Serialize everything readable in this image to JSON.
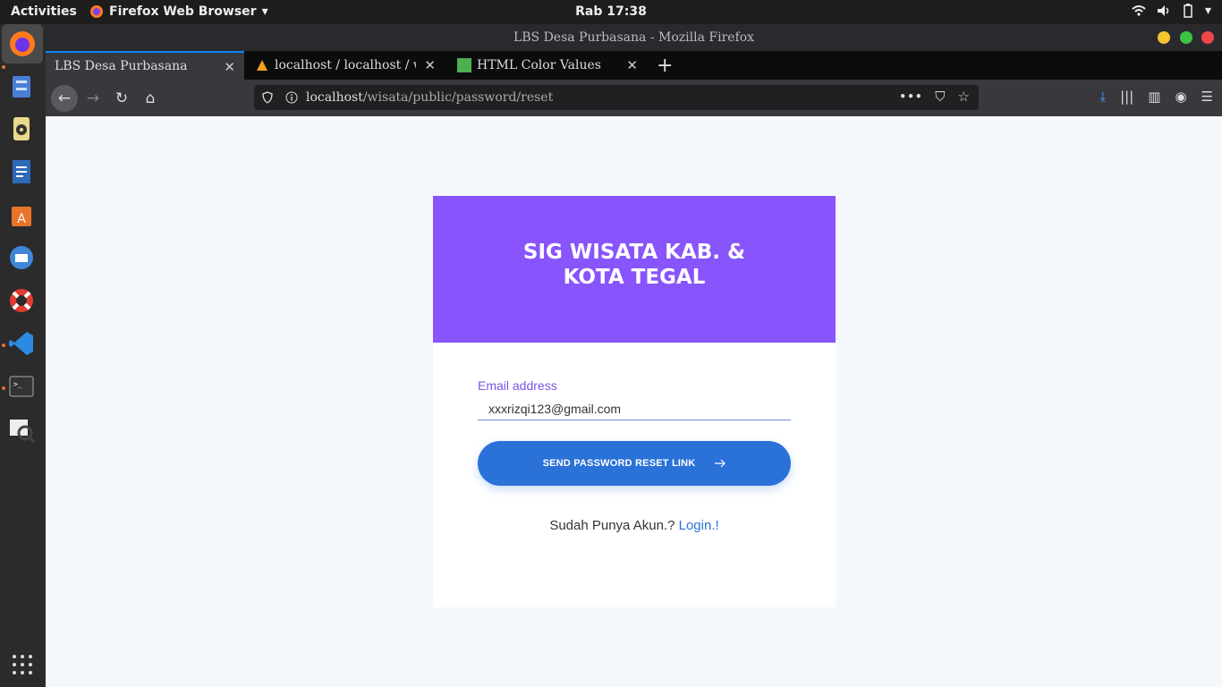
{
  "topbar": {
    "activities": "Activities",
    "app_name": "Firefox Web Browser",
    "clock": "Rab 17:38"
  },
  "window": {
    "title": "LBS Desa Purbasana - Mozilla Firefox"
  },
  "tabs": [
    {
      "label": "LBS Desa Purbasana",
      "active": true
    },
    {
      "label": "localhost / localhost / wisata",
      "active": false
    },
    {
      "label": "HTML Color Values",
      "active": false
    }
  ],
  "url": {
    "host": "localhost",
    "path": "/wisata/public/password/reset"
  },
  "form": {
    "title": "SIG WISATA KAB. & KOTA TEGAL",
    "email_label": "Email address",
    "email_value": "xxxrizqi123@gmail.com",
    "submit_label": "SEND PASSWORD RESET LINK",
    "footer_text": "Sudah Punya Akun.?",
    "login_link": "Login.!"
  },
  "colors": {
    "header": "#8854fc",
    "button": "#2a71d8",
    "label": "#7a55e8"
  }
}
